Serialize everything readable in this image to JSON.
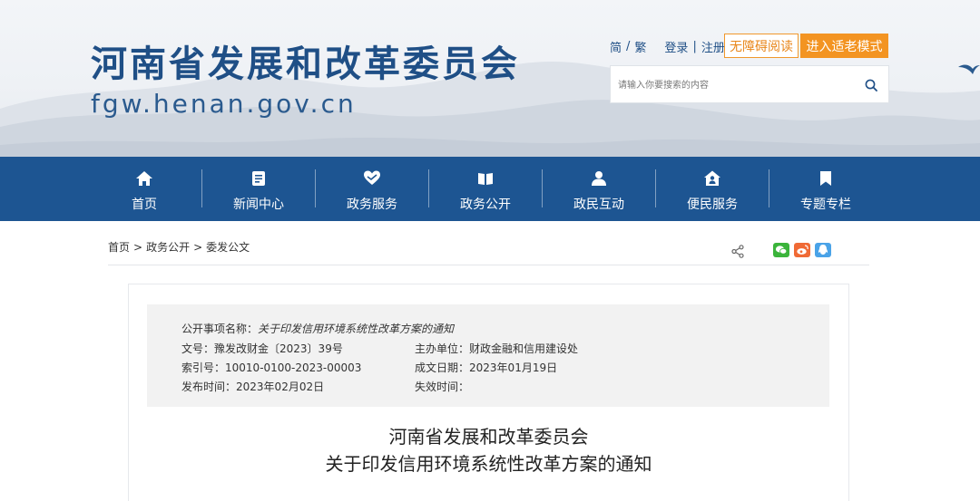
{
  "header": {
    "site_title": "河南省发展和改革委员会",
    "site_url": "fgw.henan.gov.cn",
    "top_links": {
      "simplified": "简",
      "traditional": "繁",
      "login": "登录",
      "register": "注册"
    },
    "accessible_button": "无障碍阅读",
    "elder_mode_button": "进入适老模式",
    "search": {
      "placeholder": "请输入你要搜索的内容"
    },
    "colors": {
      "title": "#1f4f86",
      "accent_orange": "#f39422"
    }
  },
  "nav": {
    "background": "#1d5592",
    "items": [
      {
        "label": "首页",
        "icon": "home-icon"
      },
      {
        "label": "新闻中心",
        "icon": "news-icon"
      },
      {
        "label": "政务服务",
        "icon": "heart-hand-icon"
      },
      {
        "label": "政务公开",
        "icon": "book-icon"
      },
      {
        "label": "政民互动",
        "icon": "people-icon"
      },
      {
        "label": "便民服务",
        "icon": "house-person-icon"
      },
      {
        "label": "专题专栏",
        "icon": "bookmark-icon"
      }
    ]
  },
  "breadcrumb": {
    "home": "首页",
    "sep": ">",
    "level1": "政务公开",
    "level2": "委发公文"
  },
  "share": {
    "icons": [
      "share-icon",
      "wechat-icon",
      "weibo-icon",
      "qq-icon"
    ]
  },
  "meta": {
    "item_name_label": "公开事项名称：",
    "item_name_value": "关于印发信用环境系统性改革方案的通知",
    "doc_no_label": "文号：",
    "doc_no_value": "豫发改财金〔2023〕39号",
    "index_no_label": "索引号：",
    "index_no_value": "10010-0100-2023-00003",
    "publish_time_label": "发布时间：",
    "publish_time_value": "2023年02月02日",
    "host_unit_label": "主办单位：",
    "host_unit_value": "财政金融和信用建设处",
    "created_date_label": "成文日期：",
    "created_date_value": "2023年01月19日",
    "expire_time_label": "失效时间：",
    "expire_time_value": ""
  },
  "article": {
    "title_line1": "河南省发展和改革委员会",
    "title_line2": "关于印发信用环境系统性改革方案的通知"
  }
}
